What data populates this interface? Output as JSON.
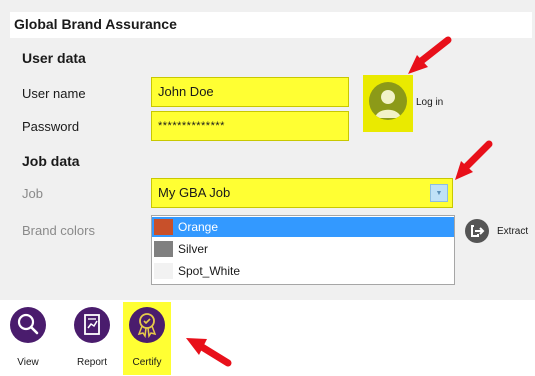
{
  "app": {
    "title": "Global Brand Assurance"
  },
  "user_data": {
    "heading": "User data",
    "username_label": "User name",
    "username_value": "John Doe",
    "password_label": "Password",
    "password_value": "**************",
    "login_label": "Log in"
  },
  "job_data": {
    "heading": "Job data",
    "job_label": "Job",
    "job_value": "My GBA Job",
    "brand_colors_label": "Brand colors",
    "brand_colors": [
      {
        "name": "Orange",
        "swatch": "#c8502a",
        "selected": true
      },
      {
        "name": "Silver",
        "swatch": "#808080",
        "selected": false
      },
      {
        "name": "Spot_White",
        "swatch": "#f2f2f2",
        "selected": false
      }
    ],
    "extract_label": "Extract"
  },
  "toolbar": {
    "view_label": "View",
    "report_label": "Report",
    "certify_label": "Certify"
  },
  "colors": {
    "highlight": "#ffff33",
    "toolbar_icon": "#4a1c6d",
    "arrow": "#e8101a",
    "avatar": "#8c9a18",
    "selection": "#3399ff"
  },
  "icons": [
    "user-avatar-icon",
    "dropdown-chevron-icon",
    "extract-icon",
    "magnifier-icon",
    "report-icon",
    "certify-badge-icon",
    "arrow-icon"
  ]
}
